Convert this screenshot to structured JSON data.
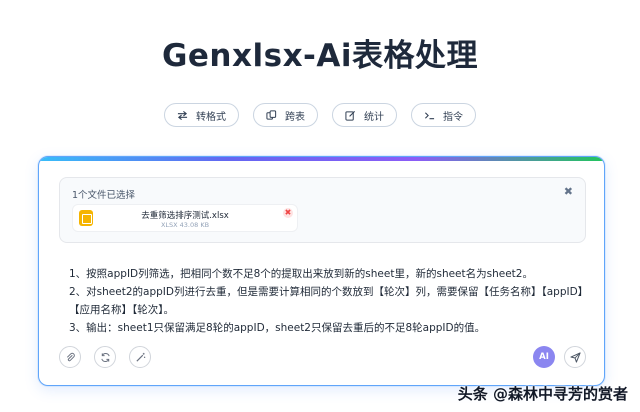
{
  "page_title": "Genxlsx-Ai表格处理",
  "modes": [
    {
      "label": "转格式",
      "icon": "swap-arrows-icon"
    },
    {
      "label": "跨表",
      "icon": "copy-sheets-icon"
    },
    {
      "label": "统计",
      "icon": "edit-icon"
    },
    {
      "label": "指令",
      "icon": "terminal-icon"
    }
  ],
  "file_panel": {
    "header": "1个文件已选择",
    "close_glyph": "✖",
    "file": {
      "name": "去重筛选排序测试.xlsx",
      "meta": "XLSX 43.08 KB",
      "remove_glyph": "✖"
    }
  },
  "instructions": [
    "1、按照appID列筛选，把相同个数不足8个的提取出来放到新的sheet里，新的sheet名为sheet2。",
    "2、对sheet2的appID列进行去重，但是需要计算相同的个数放到【轮次】列，需要保留【任务名称】【appID】【应用名称】【轮次】。",
    "3、输出：sheet1只保留满足8轮的appID，sheet2只保留去重后的不足8轮appID的值。"
  ],
  "toolbar": {
    "attach_icon": "paperclip-icon",
    "refresh_icon": "refresh-icon",
    "magic_icon": "magic-wand-icon",
    "ai_label": "AI",
    "send_icon": "send-icon"
  },
  "watermark": "头条 @森林中寻芳的赏者",
  "colors": {
    "accent": "#8b86f0",
    "panel_border": "#60a5fa",
    "file_icon": "#f5b400",
    "remove": "#ef4444"
  }
}
